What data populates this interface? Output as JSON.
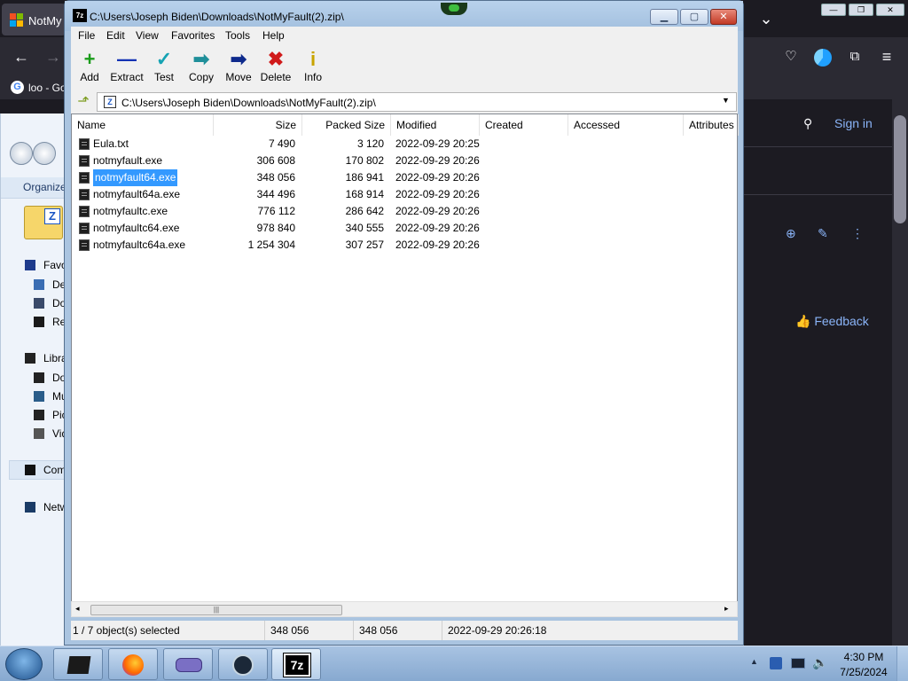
{
  "browser": {
    "tab_title": "NotMy",
    "bookmark": "loo - Go",
    "sign_in": "Sign in",
    "feedback": "Feedback"
  },
  "explorer": {
    "organize": "Organize",
    "items": [
      {
        "label": "Favo",
        "icon": "star-icon"
      },
      {
        "label": "De",
        "icon": "desktop-icon"
      },
      {
        "label": "Do",
        "icon": "downloads-icon"
      },
      {
        "label": "Re",
        "icon": "recent-icon"
      },
      {
        "label": "Libra",
        "icon": "library-icon"
      },
      {
        "label": "Do",
        "icon": "documents-icon"
      },
      {
        "label": "Mu",
        "icon": "music-icon"
      },
      {
        "label": "Pic",
        "icon": "pictures-icon"
      },
      {
        "label": "Vid",
        "icon": "videos-icon"
      },
      {
        "label": "Com",
        "icon": "computer-icon"
      },
      {
        "label": "Netw",
        "icon": "network-icon"
      }
    ]
  },
  "window": {
    "title": "C:\\Users\\Joseph Biden\\Downloads\\NotMyFault(2).zip\\",
    "menu": [
      "File",
      "Edit",
      "View",
      "Favorites",
      "Tools",
      "Help"
    ],
    "toolbar": [
      {
        "label": "Add",
        "icon": "plus-icon",
        "glyph": "+",
        "color": "#1a9c1a"
      },
      {
        "label": "Extract",
        "icon": "minus-icon",
        "glyph": "—",
        "color": "#1432b4"
      },
      {
        "label": "Test",
        "icon": "check-icon",
        "glyph": "✓",
        "color": "#16a3b3"
      },
      {
        "label": "Copy",
        "icon": "copy-arrow-icon",
        "glyph": "➡",
        "color": "#1f8f9a"
      },
      {
        "label": "Move",
        "icon": "move-arrow-icon",
        "glyph": "➡",
        "color": "#0e2a8c"
      },
      {
        "label": "Delete",
        "icon": "delete-x-icon",
        "glyph": "✖",
        "color": "#d01a1a"
      },
      {
        "label": "Info",
        "icon": "info-icon",
        "glyph": "i",
        "color": "#c8a400"
      }
    ],
    "address": "C:\\Users\\Joseph Biden\\Downloads\\NotMyFault(2).zip\\",
    "columns": [
      "Name",
      "Size",
      "Packed Size",
      "Modified",
      "Created",
      "Accessed",
      "Attributes"
    ],
    "files": [
      {
        "name": "Eula.txt",
        "size": "7 490",
        "packed": "3 120",
        "modified": "2022-09-29 20:25"
      },
      {
        "name": "notmyfault.exe",
        "size": "306 608",
        "packed": "170 802",
        "modified": "2022-09-29 20:26"
      },
      {
        "name": "notmyfault64.exe",
        "size": "348 056",
        "packed": "186 941",
        "modified": "2022-09-29 20:26"
      },
      {
        "name": "notmyfault64a.exe",
        "size": "344 496",
        "packed": "168 914",
        "modified": "2022-09-29 20:26"
      },
      {
        "name": "notmyfaultc.exe",
        "size": "776 112",
        "packed": "286 642",
        "modified": "2022-09-29 20:26"
      },
      {
        "name": "notmyfaultc64.exe",
        "size": "978 840",
        "packed": "340 555",
        "modified": "2022-09-29 20:26"
      },
      {
        "name": "notmyfaultc64a.exe",
        "size": "1 254 304",
        "packed": "307 257",
        "modified": "2022-09-29 20:26"
      }
    ],
    "status": {
      "selected": "1 / 7 object(s) selected",
      "size": "348 056",
      "packed": "348 056",
      "modified": "2022-09-29 20:26:18"
    }
  },
  "taskbar": {
    "time": "4:30 PM",
    "date": "7/25/2024"
  }
}
